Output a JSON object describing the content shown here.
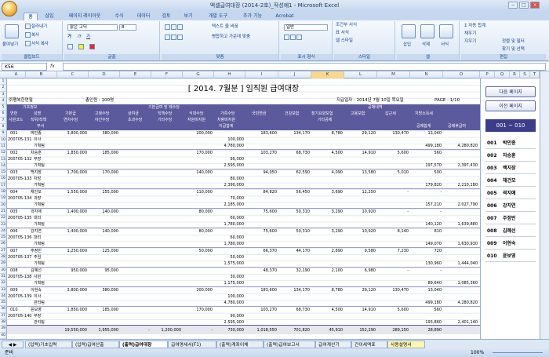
{
  "window": {
    "title": "엑셀급여대장 (2014-2호)_작성예1 - Microsoft Excel",
    "controls": [
      "−",
      "□",
      "×"
    ]
  },
  "ribbon_tabs": [
    "홈",
    "삽입",
    "페이지 레이아웃",
    "수식",
    "데이터",
    "검토",
    "보기",
    "개발 도구",
    "추가 기능",
    "Acrobat"
  ],
  "ribbon": {
    "clipboard": {
      "paste": "붙여넣기",
      "cut": "잘라내기",
      "copy": "복사",
      "format_painter": "서식 복사",
      "label": "클립보드"
    },
    "font": {
      "name": "맑은 고딕",
      "size": "8",
      "bold": "가",
      "italic": "가",
      "underline": "가",
      "label": "글꼴"
    },
    "align": {
      "wrap": "텍스트 줄 바꿈",
      "merge": "병합하고 가운데 맞춤",
      "label": "맞춤"
    },
    "number": {
      "format": "일반",
      "label": "표시 형식"
    },
    "style": {
      "cond": "조건부 서식",
      "table": "표 서식",
      "cell": "셀 스타일",
      "label": "스타일"
    },
    "cells": {
      "insert": "삽입",
      "delete": "삭제",
      "format": "서식",
      "label": "셀"
    },
    "edit": {
      "autosum": "자동 합계",
      "fill": "채우기",
      "clear": "지우기",
      "sort": "정렬 및 필터",
      "find": "찾기 및 선택",
      "label": "편집"
    }
  },
  "formula_bar": {
    "name_box": "K56",
    "fx": "fx",
    "content": ""
  },
  "columns": [
    "A",
    "B",
    "C",
    "D",
    "E",
    "F",
    "G",
    "H",
    "I",
    "J",
    "K",
    "L",
    "M",
    "N",
    "O",
    "P",
    "Q",
    "R",
    "S",
    "T"
  ],
  "rows": [
    "1",
    "2",
    "3",
    "4",
    "5",
    "6",
    "7",
    "8",
    "9",
    "10",
    "11",
    "12",
    "13",
    "14",
    "15",
    "16",
    "17",
    "18",
    "19",
    "20",
    "21",
    "22",
    "23",
    "24",
    "25",
    "26",
    "27",
    "28",
    "29",
    "30",
    "31",
    "32",
    "33",
    "34",
    "35",
    "36",
    "37",
    "38",
    "39",
    "40"
  ],
  "report": {
    "title": "[ 2014. 7월분 ]  임직원 급여대장",
    "company": "㈜행복한연필",
    "headcount": "총인원 : 100명",
    "pay_date": "지급일자 : 2014년 7월 10일 목요일",
    "page": "PAGE : 1/10"
  },
  "header": {
    "group_basic": "기초정보",
    "group_pay": "기본급여 및 제수당",
    "group_deduct": "공제내역",
    "col_year": "연번",
    "col_name": "성명",
    "col_empno": "사원코드",
    "col_rank": "직위/직책",
    "col_dept": "부서",
    "col_base": "기본급",
    "col_fixed": "고정수당",
    "col_bonus": "상여금",
    "col_title_allow": "직책수당",
    "col_meal": "식대수당",
    "col_night": "야간수당",
    "col_family": "가족수당",
    "col_total": "자원비지원",
    "col_paid": "지급합계",
    "col_overtime": "연차수당",
    "col_extra": "초과수당",
    "col_other": "기타수당",
    "col_car": "차량비지원",
    "col_np": "국민연금",
    "col_health": "건강보험",
    "col_ltc": "장기요양보험",
    "col_ltc2": "기타공제",
    "col_emp": "고용보험",
    "col_income": "갑근세",
    "col_local": "지방소득세",
    "col_total_ded": "공제합계",
    "col_net": "공제후급여"
  },
  "employees": [
    {
      "no": "001",
      "code": "200705-131",
      "name": "박민종",
      "rank": "이사",
      "dept": "기획팀",
      "base": "3,800,000",
      "fixed": "380,000",
      "title_allow": "200,000",
      "meal": "100,000",
      "family": "100,000",
      "paid": "4,780,000",
      "np": "183,600",
      "health": "134,170",
      "ltc": "8,780",
      "emp": "29,120",
      "income": "130,470",
      "local": "13,040",
      "ded": "499,180",
      "net": "4,280,820"
    },
    {
      "no": "002",
      "code": "200705-132",
      "name": "차승훈",
      "rank": "부장",
      "dept": "기획팀",
      "base": "1,850,000",
      "fixed": "185,000",
      "title_allow": "170,000",
      "meal": "90,000",
      "family": "100,000",
      "paid": "2,595,000",
      "np": "103,270",
      "health": "68,730",
      "ltc": "4,500",
      "emp": "14,910",
      "income": "5,600",
      "local": "560",
      "ded": "197,570",
      "net": "2,397,430"
    },
    {
      "no": "003",
      "code": "200705-133",
      "name": "백지장",
      "rank": "차장",
      "dept": "기획팀",
      "base": "1,700,000",
      "fixed": "170,000",
      "title_allow": "140,000",
      "meal": "80,000",
      "family": "100,000",
      "paid": "2,390,000",
      "np": "94,050",
      "health": "62,590",
      "ltc": "4,090",
      "emp": "13,580",
      "income": "5,010",
      "local": "500",
      "ded": "179,820",
      "net": "2,210,180"
    },
    {
      "no": "004",
      "code": "200705-134",
      "name": "채건모",
      "rank": "과장",
      "dept": "기획팀",
      "base": "1,550,000",
      "fixed": "155,000",
      "title_allow": "110,000",
      "meal": "70,000",
      "family": "100,000",
      "paid": "2,185,000",
      "np": "84,820",
      "health": "56,450",
      "ltc": "3,690",
      "emp": "12,250",
      "income": "-",
      "local": "-",
      "ded": "157,210",
      "net": "2,027,790"
    },
    {
      "no": "005",
      "code": "200705-135",
      "name": "곽지애",
      "rank": "대리",
      "dept": "기획팀",
      "base": "1,400,000",
      "fixed": "140,000",
      "title_allow": "80,000",
      "meal": "60,000",
      "family": "100,000",
      "paid": "1,780,000",
      "np": "75,600",
      "health": "50,310",
      "ltc": "3,290",
      "emp": "10,920",
      "income": "-",
      "local": "-",
      "ded": "140,120",
      "net": "1,639,880"
    },
    {
      "no": "006",
      "code": "200705-136",
      "name": "강지연",
      "rank": "대리",
      "dept": "기획팀",
      "base": "1,400,000",
      "fixed": "140,000",
      "title_allow": "80,000",
      "meal": "60,000",
      "family": "100,000",
      "paid": "1,780,000",
      "np": "75,600",
      "health": "50,310",
      "ltc": "3,290",
      "emp": "10,920",
      "income": "8,140",
      "local": "810",
      "ded": "149,070",
      "net": "1,630,930"
    },
    {
      "no": "007",
      "code": "200705-137",
      "name": "주정민",
      "rank": "주임",
      "dept": "기획팀",
      "base": "1,250,000",
      "fixed": "125,000",
      "title_allow": "50,000",
      "meal": "50,000",
      "family": "100,000",
      "paid": "1,575,000",
      "np": "66,370",
      "health": "44,170",
      "ltc": "2,890",
      "emp": "9,580",
      "income": "7,230",
      "local": "720",
      "ded": "130,960",
      "net": "1,444,040"
    },
    {
      "no": "008",
      "code": "200705-138",
      "name": "김혜선",
      "rank": "사원",
      "dept": "기획팀",
      "base": "950,000",
      "fixed": "95,000",
      "title_allow": "",
      "meal": "30,000",
      "family": "100,000",
      "paid": "1,175,000",
      "np": "48,370",
      "health": "32,190",
      "ltc": "2,100",
      "emp": "6,980",
      "income": "-",
      "local": "-",
      "ded": "89,640",
      "net": "1,085,360"
    },
    {
      "no": "009",
      "code": "200705-139",
      "name": "이현숙",
      "rank": "이사",
      "dept": "관리팀",
      "base": "3,800,000",
      "fixed": "380,000",
      "title_allow": "200,000",
      "meal": "100,000",
      "family": "100,000",
      "paid": "4,780,000",
      "np": "183,600",
      "health": "134,170",
      "ltc": "8,780",
      "emp": "29,120",
      "income": "130,470",
      "local": "13,040",
      "ded": "499,180",
      "net": "4,280,820"
    },
    {
      "no": "010",
      "code": "200705-140",
      "name": "윤보영",
      "rank": "부장",
      "dept": "관리팀",
      "base": "1,850,000",
      "fixed": "185,000",
      "title_allow": "170,000",
      "meal": "90,000",
      "family": "100,000",
      "paid": "2,595,000",
      "np": "103,270",
      "health": "68,730",
      "ltc": "4,500",
      "emp": "14,910",
      "income": "5,600",
      "local": "560",
      "ded": "193,860",
      "net": "2,401,140"
    }
  ],
  "totals": {
    "base": "19,550,000",
    "fixed": "1,955,000",
    "bonus": "-",
    "title_allow": "1,200,000",
    "meal": "-",
    "night": "730,000",
    "paid": "",
    "np": "1,018,550",
    "health": "701,820",
    "ltc": "45,910",
    "emp": "152,290",
    "income": "289,150",
    "local": "28,890"
  },
  "side_panel": {
    "next": "다음 페이지",
    "prev": "이전 페이지",
    "range": "001 ~ 010",
    "list": [
      {
        "id": "001",
        "name": "박민종"
      },
      {
        "id": "002",
        "name": "차승훈"
      },
      {
        "id": "003",
        "name": "백지장"
      },
      {
        "id": "004",
        "name": "채건모"
      },
      {
        "id": "005",
        "name": "곽지애"
      },
      {
        "id": "006",
        "name": "강지연"
      },
      {
        "id": "007",
        "name": "주정민"
      },
      {
        "id": "008",
        "name": "김혜선"
      },
      {
        "id": "009",
        "name": "이현숙"
      },
      {
        "id": "010",
        "name": "윤보영"
      }
    ]
  },
  "sheet_tabs": [
    "(입력)기초입력",
    "(입력)급여산출",
    "(출력)급여대장",
    "급여명세서(F1)",
    "(출력)계좌이체",
    "(출력)급여보고서",
    "급여계산기",
    "간이세액표",
    "사용설명서"
  ],
  "status": {
    "ready": "준비",
    "zoom": "100%"
  },
  "colors": {
    "header_band": "#5a5a9c",
    "range_bg": "#3c3c8a",
    "ribbon": "#dbe7f5"
  }
}
